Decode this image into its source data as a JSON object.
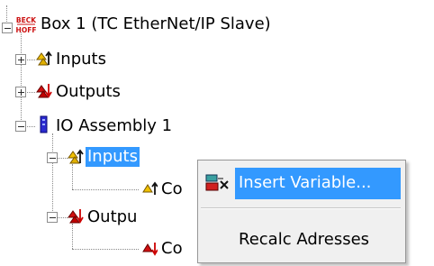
{
  "tree": {
    "root": {
      "label": "Box 1 (TC EtherNet/IP Slave)",
      "icon": "beckhoff-logo-icon",
      "logo_text": [
        "BECK",
        "HOFF"
      ]
    },
    "items": [
      {
        "label": "Inputs",
        "icon": "inputs-icon"
      },
      {
        "label": "Outputs",
        "icon": "outputs-icon"
      },
      {
        "label": "IO Assembly 1",
        "icon": "io-assembly-icon"
      },
      {
        "label": "Inputs",
        "icon": "inputs-icon",
        "selected": true
      },
      {
        "label": "Co",
        "icon": "input-variable-icon"
      },
      {
        "label": "Outpu",
        "icon": "outputs-icon"
      },
      {
        "label": "Co",
        "icon": "output-variable-icon"
      }
    ]
  },
  "context_menu": {
    "items": [
      {
        "label": "Insert Variable...",
        "icon": "insert-variable-icon",
        "highlighted": true
      },
      {
        "label": "Recalc Adresses"
      }
    ]
  },
  "colors": {
    "selection": "#3399ff",
    "menu_bg": "#f0f0f0",
    "input_icon": "#c8a000",
    "output_icon": "#c00000",
    "assembly_icon": "#2222cc"
  }
}
